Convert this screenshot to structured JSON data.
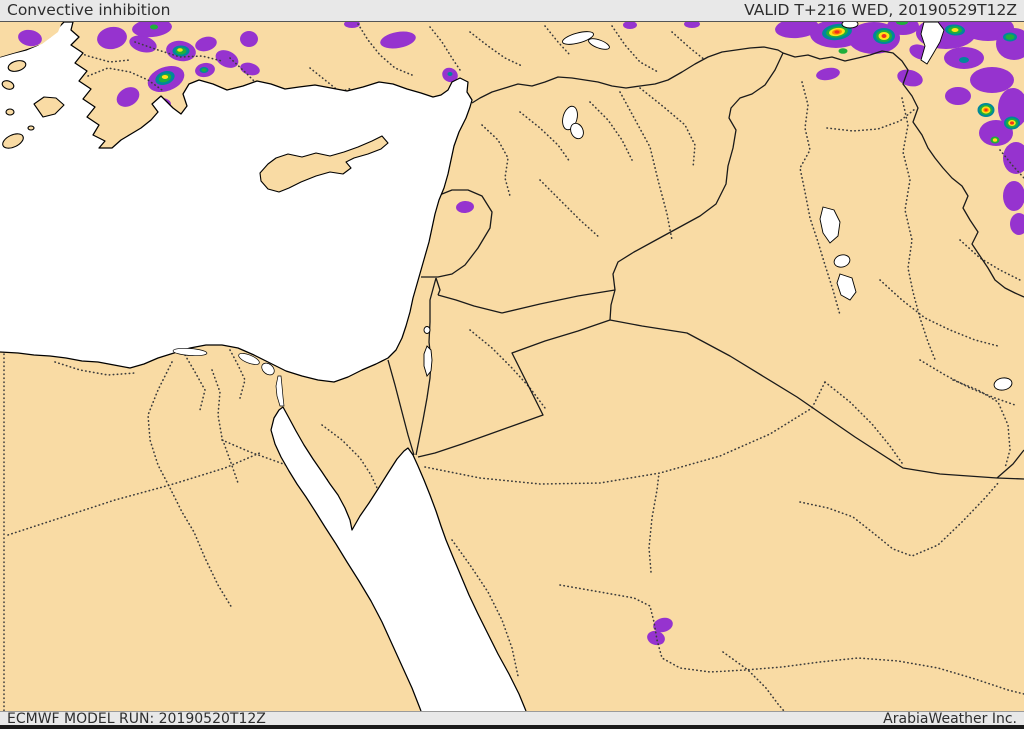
{
  "header": {
    "title": "Convective inhibition",
    "valid_label": "VALID T+216 WED, 20190529T12Z"
  },
  "footer": {
    "model_run": "ECMWF MODEL RUN: 20190520T12Z",
    "company": "ArabiaWeather Inc."
  },
  "colors": {
    "land": "#f9dba4",
    "sea": "#ffffff",
    "coast": "#000000",
    "border": "#1a1a1a",
    "admin": "#3c3c3c",
    "cin_level1": "#9633cf",
    "cin_level2": "#00889b",
    "cin_level3": "#1faf3c",
    "cin_level4": "#ffe218",
    "cin_level5": "#ff8c00",
    "cin_level6": "#f2301b",
    "chrome_bg": "#e8e8e8",
    "chrome_text": "#2d2d2d"
  }
}
